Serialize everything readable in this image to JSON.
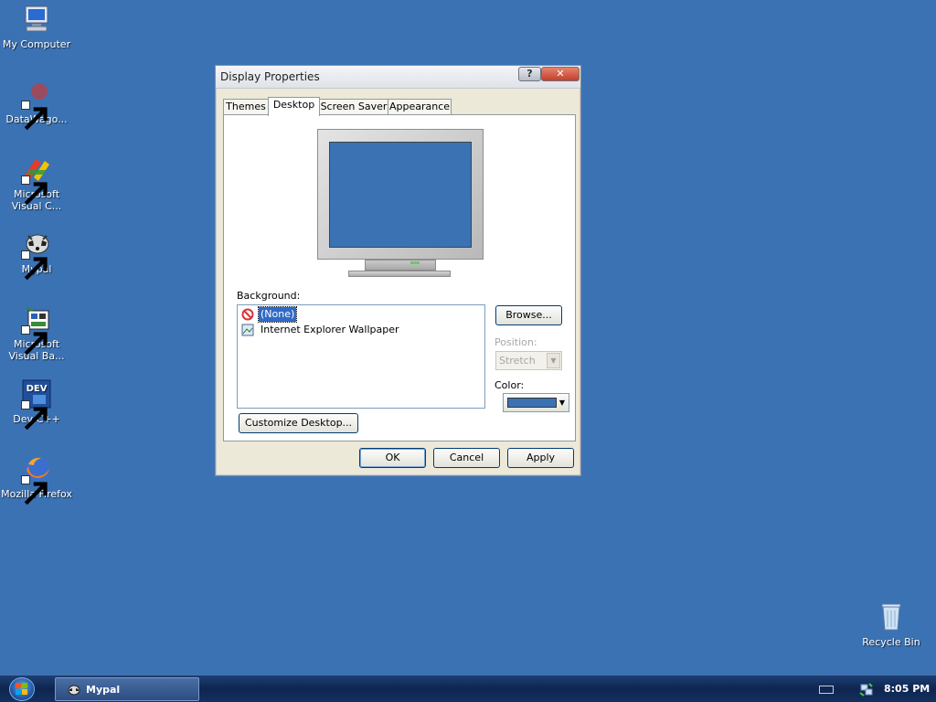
{
  "desktop": {
    "background_color": "#3b72b4",
    "icons": [
      {
        "label": "My Computer",
        "icon": "my-computer-icon"
      },
      {
        "label": "DataWago...",
        "icon": "datawago-icon"
      },
      {
        "label": "Microsoft Visual C...",
        "icon": "visual-cpp-icon"
      },
      {
        "label": "Mypal",
        "icon": "mypal-icon"
      },
      {
        "label": "Microsoft Visual Ba...",
        "icon": "visual-basic-icon"
      },
      {
        "label": "Dev-C++",
        "icon": "dev-cpp-icon"
      },
      {
        "label": "Mozilla Firefox",
        "icon": "firefox-icon"
      },
      {
        "label": "Recycle Bin",
        "icon": "recycle-bin-icon"
      }
    ]
  },
  "dialog": {
    "title": "Display Properties",
    "help_button": "?",
    "close_button": "✕",
    "tabs": [
      {
        "label": "Themes",
        "active": false
      },
      {
        "label": "Desktop",
        "active": true
      },
      {
        "label": "Screen Saver",
        "active": false
      },
      {
        "label": "Appearance",
        "active": false
      }
    ],
    "background_label": "Background:",
    "background_items": [
      {
        "label": "(None)",
        "icon": "no-symbol-icon",
        "selected": true
      },
      {
        "label": "Internet Explorer Wallpaper",
        "icon": "wallpaper-file-icon",
        "selected": false
      }
    ],
    "browse_button": "Browse...",
    "position_label": "Position:",
    "position_value": "Stretch",
    "color_label": "Color:",
    "color_value": "#3b72b4",
    "customize_button": "Customize Desktop...",
    "ok_button": "OK",
    "cancel_button": "Cancel",
    "apply_button": "Apply"
  },
  "taskbar": {
    "task_label": "Mypal",
    "clock": "8:05 PM"
  }
}
